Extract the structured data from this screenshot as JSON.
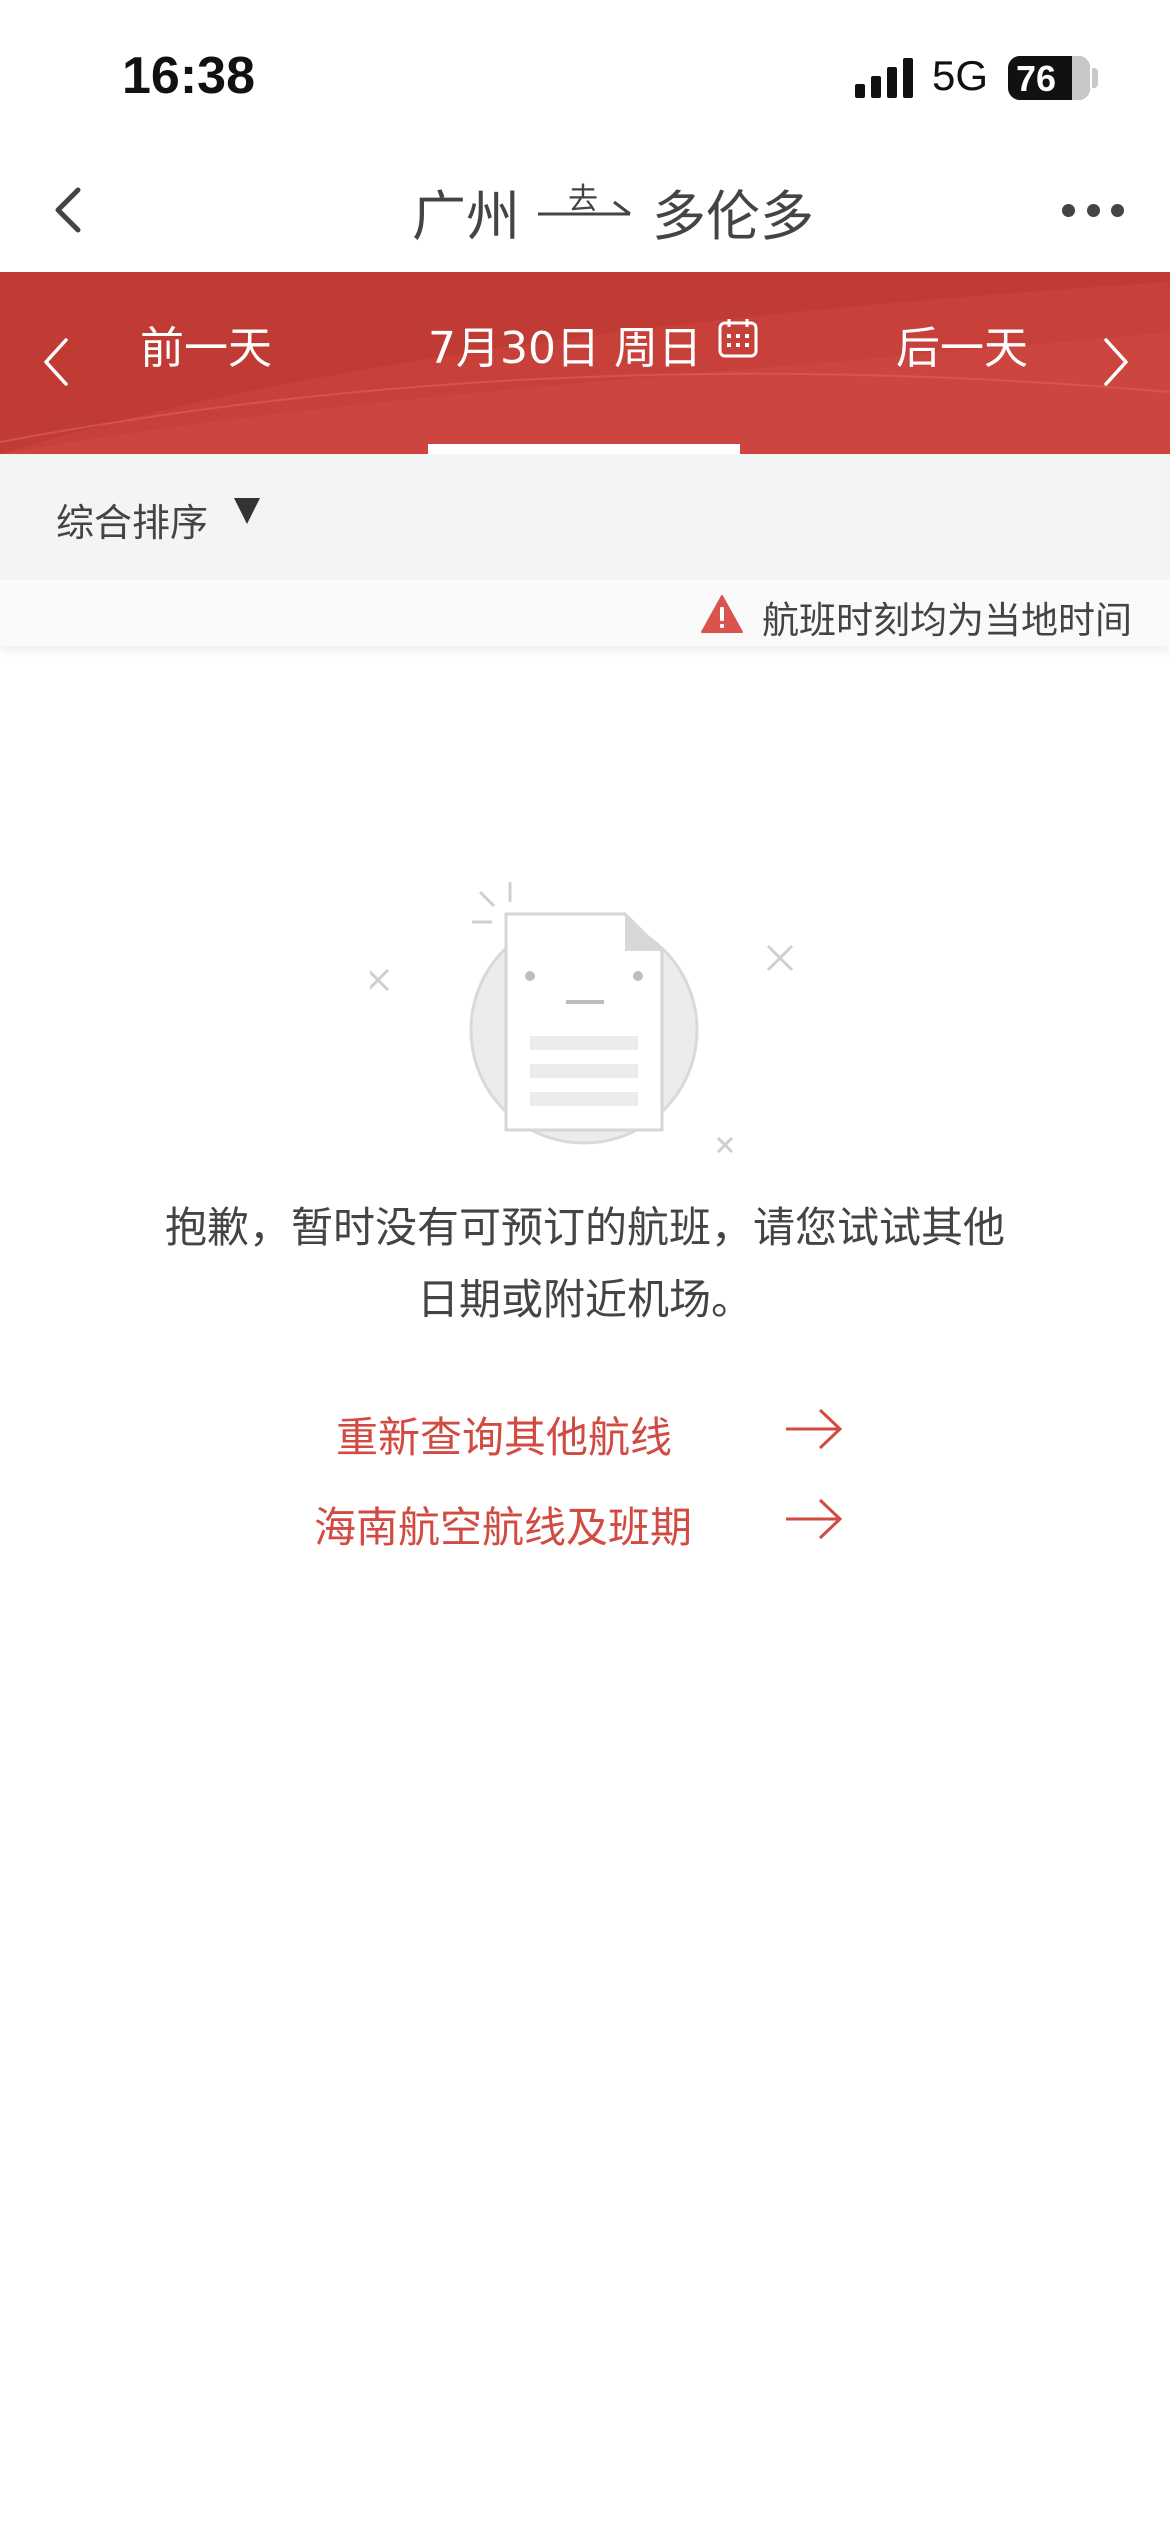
{
  "status_bar": {
    "time": "16:38",
    "network": "5G",
    "battery": "76"
  },
  "nav": {
    "origin": "广州",
    "direction": "去",
    "destination": "多伦多"
  },
  "date_bar": {
    "prev_label": "前一天",
    "current_date": "7月30日  周日",
    "next_label": "后一天"
  },
  "sort": {
    "label": "综合排序"
  },
  "notice": {
    "text": "航班时刻均为当地时间"
  },
  "empty_state": {
    "message_line1": "抱歉，暂时没有可预订的航班，请您试试其他",
    "message_line2": "日期或附近机场。"
  },
  "actions": {
    "requery_label": "重新查询其他航线",
    "hainan_routes_label": "海南航空航线及班期"
  },
  "colors": {
    "brand_red": "#c8403a",
    "link_red": "#d24b42",
    "warning_red": "#d9534f"
  },
  "icons": {
    "back": "chevron-left-icon",
    "more": "more-dots-icon",
    "calendar": "calendar-icon",
    "warning": "warning-icon",
    "arrow": "arrow-right-icon"
  }
}
